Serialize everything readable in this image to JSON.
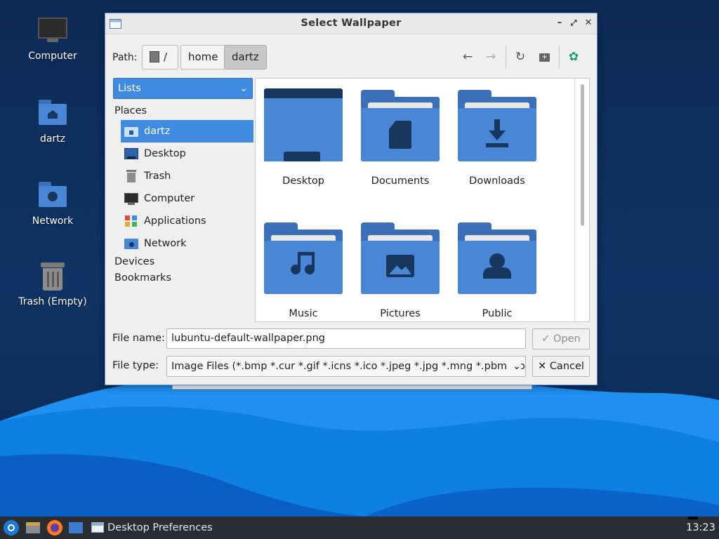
{
  "desktop": {
    "icons": [
      {
        "label": "Computer",
        "icon": "computer-icon"
      },
      {
        "label": "dartz",
        "icon": "home-folder-icon"
      },
      {
        "label": "Network",
        "icon": "network-folder-icon"
      },
      {
        "label": "Trash (Empty)",
        "icon": "trash-icon"
      }
    ]
  },
  "dialog": {
    "title": "Select Wallpaper",
    "path_label": "Path:",
    "breadcrumbs": [
      "/",
      "home",
      "dartz"
    ],
    "sidebar": {
      "view_mode": "Lists",
      "places_heading": "Places",
      "places": [
        {
          "label": "dartz",
          "icon": "home-folder-icon",
          "selected": true
        },
        {
          "label": "Desktop",
          "icon": "desktop-icon"
        },
        {
          "label": "Trash",
          "icon": "trash-icon"
        },
        {
          "label": "Computer",
          "icon": "computer-icon"
        },
        {
          "label": "Applications",
          "icon": "applications-icon"
        },
        {
          "label": "Network",
          "icon": "network-icon"
        }
      ],
      "devices_heading": "Devices",
      "bookmarks_heading": "Bookmarks"
    },
    "files": [
      {
        "label": "Desktop",
        "icon": "desktop-folder-icon"
      },
      {
        "label": "Documents",
        "icon": "documents-folder-icon"
      },
      {
        "label": "Downloads",
        "icon": "downloads-folder-icon"
      },
      {
        "label": "Music",
        "icon": "music-folder-icon"
      },
      {
        "label": "Pictures",
        "icon": "pictures-folder-icon"
      },
      {
        "label": "Public",
        "icon": "public-folder-icon"
      }
    ],
    "file_name_label": "File name:",
    "file_name_value": "lubuntu-default-wallpaper.png",
    "file_type_label": "File type:",
    "file_type_value": "Image Files (*.bmp *.cur *.gif *.icns *.ico *.jpeg *.jpg *.mng *.pbm *.pgm",
    "open_label": "Open",
    "cancel_label": "Cancel"
  },
  "taskbar": {
    "window_title": "Desktop Preferences",
    "clock": "13:23"
  },
  "colors": {
    "accent": "#3f8ae2",
    "folder": "#4a86d6",
    "folder_dark": "#17375e",
    "taskbar": "#2a2d32"
  }
}
